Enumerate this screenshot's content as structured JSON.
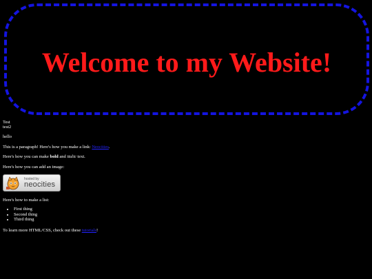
{
  "header": {
    "title": "Welcome to my Website!"
  },
  "content": {
    "line1": "Test",
    "line2": "test2",
    "hello": "hello",
    "para_text": "This is a paragraph! Here's how you make a link: ",
    "para_link": "Neocities",
    "para_end": ".",
    "fmt_pre": "Here's how you can make ",
    "fmt_bold": "bold",
    "fmt_mid": " and ",
    "fmt_italic": "italic",
    "fmt_end": " text.",
    "image_intro": "Here's how you can add an image:",
    "badge": {
      "hosted_by": "hosted by",
      "brand": "neocities"
    },
    "list_intro": "Here's how to make a list:",
    "list_items": [
      "First thing",
      "Second thing",
      "Third thing"
    ],
    "learn_pre": "To learn more HTML/CSS, check out these ",
    "learn_link": "tutorials",
    "learn_end": "!"
  },
  "colors": {
    "background": "#000000",
    "title": "#ff1a1a",
    "border": "#1414e0",
    "link": "#2323ff"
  }
}
